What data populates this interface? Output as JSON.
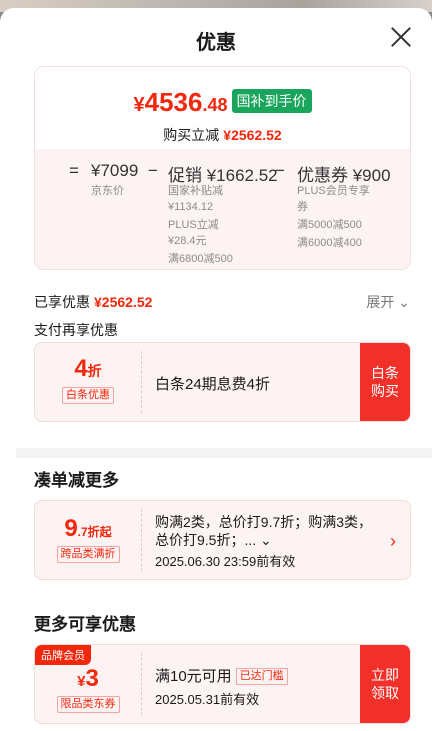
{
  "header": {
    "title": "优惠"
  },
  "price_card": {
    "currency": "¥",
    "final_int": "4536",
    "final_dec": ".48",
    "gov_badge": "国补到手价",
    "instant_label": "购买立减",
    "instant_amount": "¥2562.52",
    "eq": "=",
    "jd_price": "¥7099",
    "jd_label": "京东价",
    "minus1": "−",
    "promo": "促销 ¥1662.52",
    "promo_lines": [
      "国家补贴减",
      "¥1134.12",
      "PLUS立减",
      "¥28.4元",
      "满6800减500"
    ],
    "minus2": "−",
    "coupon": "优惠券 ¥900",
    "coupon_lines": [
      "PLUS会员专享",
      "券",
      "满5000减500",
      "满6000减400"
    ]
  },
  "summary": {
    "enjoyed_label": "已享优惠",
    "enjoyed_amount": "¥2562.52",
    "expand": "展开",
    "pay_more": "支付再享优惠"
  },
  "baitiao": {
    "big": "4",
    "unit": "折",
    "tag": "白条优惠",
    "desc": "白条24期息费4折",
    "btn_line1": "白条",
    "btn_line2": "购买"
  },
  "combine": {
    "title": "凑单减更多",
    "big": "9",
    "small": ".7折起",
    "tag": "跨品类满折",
    "desc": "购满2类，总价打9.7折；购满3类，总价打9.5折；...",
    "date": "2025.06.30 23:59前有效"
  },
  "more": {
    "title": "更多可享优惠",
    "brand_tag": "品牌会员",
    "currency": "¥",
    "big": "3",
    "tag": "限品类东券",
    "desc": "满10元可用",
    "reached": "已达门槛",
    "date": "2025.05.31前有效",
    "btn_line1": "立即",
    "btn_line2": "领取"
  }
}
